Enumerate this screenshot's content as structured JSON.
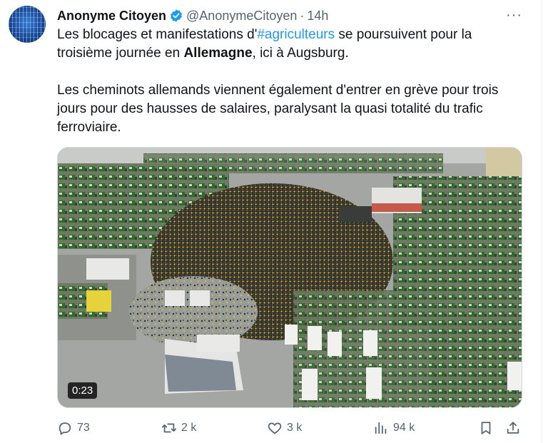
{
  "tweet": {
    "author_name": "Anonyme Citoyen",
    "handle": "@AnonymeCitoyen",
    "separator": "·",
    "time": "14h",
    "more": "···",
    "para1_a": "Les blocages et manifestations d'",
    "hashtag": "#agriculteurs",
    "para1_b": " se poursuivent pour la troisième journée en ",
    "para1_bold": "Allemagne",
    "para1_c": ", ici à Augsburg.",
    "para2": "Les cheminots allemands viennent également d'entrer en grève pour trois jours pour des hausses de salaires, paralysant la quasi totalité du trafic ferroviaire.",
    "video_duration": "0:23"
  },
  "actions": {
    "replies": "73",
    "retweets": "2 k",
    "likes": "3 k",
    "views": "94 k"
  },
  "colors": {
    "accent": "#1d9bf0",
    "muted": "#536471",
    "text": "#0f1419"
  },
  "icons": [
    "verified-badge-icon",
    "more-icon",
    "reply-icon",
    "retweet-icon",
    "like-icon",
    "views-icon",
    "bookmark-icon",
    "share-icon"
  ]
}
